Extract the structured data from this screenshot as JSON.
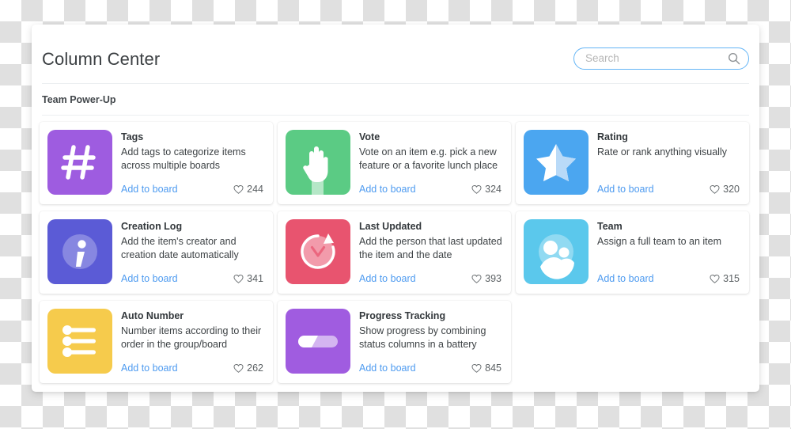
{
  "header": {
    "title": "Column Center",
    "search": {
      "placeholder": "Search",
      "value": "",
      "icon": "search-icon",
      "border_color": "#64b5f6"
    }
  },
  "section": {
    "label": "Team Power-Up"
  },
  "common": {
    "add_label": "Add to board",
    "like_icon": "heart-icon"
  },
  "cards": [
    {
      "title": "Tags",
      "description": "Add tags to categorize items across multiple boards",
      "add_label": "Add to board",
      "likes": "244",
      "icon": "hash-icon",
      "color": "#9e5ce0"
    },
    {
      "title": "Vote",
      "description": "Vote on an item e.g. pick a new feature or a favorite lunch place",
      "add_label": "Add to board",
      "likes": "324",
      "icon": "raised-hand-icon",
      "color": "#5bcb84"
    },
    {
      "title": "Rating",
      "description": "Rate or rank anything visually",
      "add_label": "Add to board",
      "likes": "320",
      "icon": "star-icon",
      "color": "#4ba6f0"
    },
    {
      "title": "Creation Log",
      "description": "Add the item's creator and creation date automatically",
      "add_label": "Add to board",
      "likes": "341",
      "icon": "info-icon",
      "color": "#5b5bd6"
    },
    {
      "title": "Last Updated",
      "description": "Add the person that last updated the item and the date",
      "add_label": "Add to board",
      "likes": "393",
      "icon": "history-clock-icon",
      "color": "#e8546f"
    },
    {
      "title": "Team",
      "description": "Assign a full team to an item",
      "add_label": "Add to board",
      "likes": "315",
      "icon": "people-icon",
      "color": "#5bc8ec"
    },
    {
      "title": "Auto Number",
      "description": "Number items according to their order in the group/board",
      "add_label": "Add to board",
      "likes": "262",
      "icon": "numbered-list-icon",
      "color": "#f6cb4c"
    },
    {
      "title": "Progress Tracking",
      "description": "Show progress by combining status columns in a battery",
      "add_label": "Add to board",
      "likes": "845",
      "icon": "battery-progress-icon",
      "color": "#a05ce0"
    }
  ]
}
